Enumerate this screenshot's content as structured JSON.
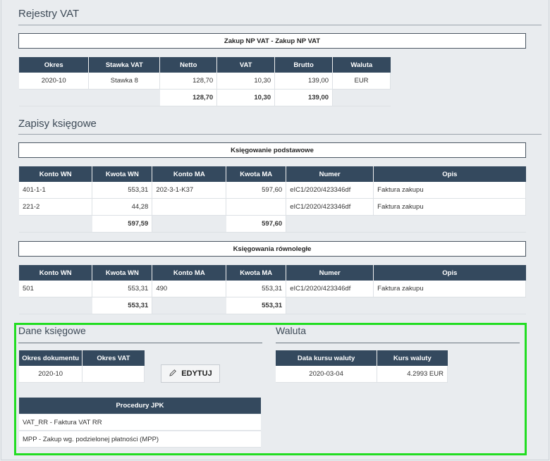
{
  "vat": {
    "title": "Rejestry VAT",
    "box_title": "Zakup NP VAT - Zakup NP VAT",
    "headers": [
      "Okres",
      "Stawka VAT",
      "Netto",
      "VAT",
      "Brutto",
      "Waluta"
    ],
    "row": [
      "2020-10",
      "Stawka 8",
      "128,70",
      "10,30",
      "139,00",
      "EUR"
    ],
    "totals": {
      "netto": "128,70",
      "vat": "10,30",
      "brutto": "139,00"
    }
  },
  "zapisy": {
    "title": "Zapisy księgowe",
    "basic": {
      "box_title": "Księgowanie podstawowe",
      "headers": [
        "Konto WN",
        "Kwota WN",
        "Konto MA",
        "Kwota MA",
        "Numer",
        "Opis"
      ],
      "rows": [
        [
          "401-1-1",
          "553,31",
          "202-3-1-K37",
          "597,60",
          "eIC1/2020/423346df",
          "Faktura zakupu"
        ],
        [
          "221-2",
          "44,28",
          "",
          "",
          "eIC1/2020/423346df",
          "Faktura zakupu"
        ]
      ],
      "totals": {
        "wn": "597,59",
        "ma": "597,60"
      }
    },
    "parallel": {
      "box_title": "Księgowania równoległe",
      "headers": [
        "Konto WN",
        "Kwota WN",
        "Konto MA",
        "Kwota MA",
        "Numer",
        "Opis"
      ],
      "rows": [
        [
          "501",
          "553,31",
          "490",
          "553,31",
          "eIC1/2020/423346df",
          "Faktura zakupu"
        ]
      ],
      "totals": {
        "wn": "553,31",
        "ma": "553,31"
      }
    }
  },
  "dane": {
    "title": "Dane księgowe",
    "headers": [
      "Okres dokumentu",
      "Okres VAT"
    ],
    "row": [
      "2020-10",
      ""
    ],
    "edit_label": "EDYTUJ",
    "edit_icon": "pencil-icon",
    "jpk_title": "Procedury JPK",
    "jpk_items": [
      "VAT_RR - Faktura VAT RR",
      "MPP - Zakup wg. podzielonej płatności (MPP)"
    ]
  },
  "waluta": {
    "title": "Waluta",
    "headers": [
      "Data kursu waluty",
      "Kurs waluty"
    ],
    "row": [
      "2020-03-04",
      "4.2993 EUR"
    ]
  },
  "colors": {
    "header_bg": "#34495e",
    "highlight": "#22dd22",
    "page_bg": "#e9ecef"
  }
}
